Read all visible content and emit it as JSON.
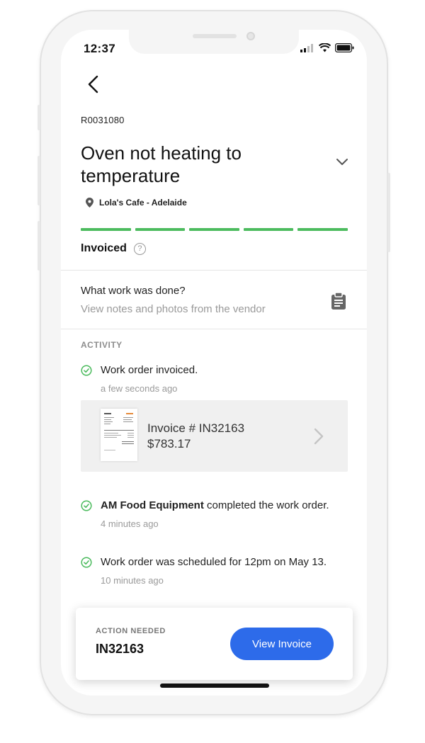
{
  "status_bar": {
    "time": "12:37"
  },
  "order": {
    "id": "R0031080",
    "title": "Oven not heating to temperature",
    "location": "Lola's Cafe - Adelaide",
    "progress_steps_complete": 5,
    "progress_steps_total": 5,
    "status": "Invoiced",
    "help_glyph": "?"
  },
  "work_done": {
    "title": "What work was done?",
    "subtitle": "View notes and photos from the vendor"
  },
  "activity": {
    "label": "ACTIVITY",
    "items": [
      {
        "text": "Work order invoiced.",
        "time": "a few seconds ago"
      },
      {
        "bold": "AM Food Equipment",
        "text": " completed the work order.",
        "time": "4 minutes ago"
      },
      {
        "text": "Work order was scheduled for 12pm on May 13.",
        "time": "10 minutes ago"
      }
    ],
    "invoice": {
      "number": "Invoice # IN32163",
      "amount": "$783.17"
    }
  },
  "action": {
    "label": "ACTION NEEDED",
    "value": "IN32163",
    "button": "View Invoice"
  },
  "colors": {
    "accent": "#2d6bea",
    "success": "#4cbb5e"
  }
}
